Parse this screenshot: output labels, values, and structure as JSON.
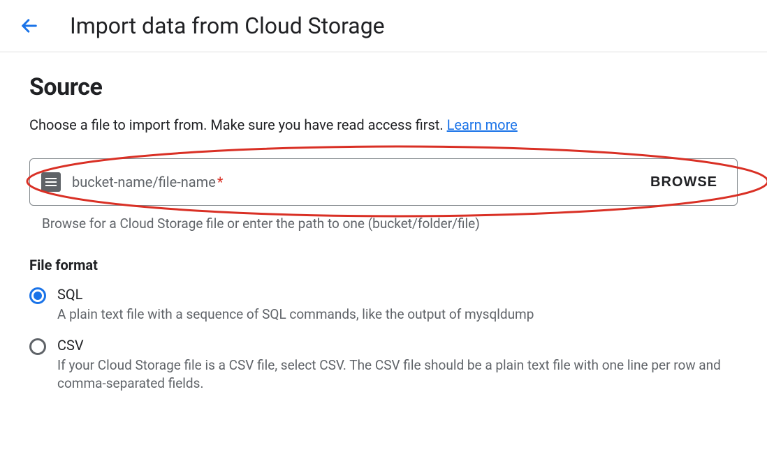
{
  "header": {
    "title": "Import data from Cloud Storage"
  },
  "source": {
    "heading": "Source",
    "description": "Choose a file to import from. Make sure you have read access first. ",
    "learn_more_label": "Learn more",
    "input_placeholder": "bucket-name/file-name",
    "required_star": "*",
    "browse_label": "BROWSE",
    "helper_text": "Browse for a Cloud Storage file or enter the path to one (bucket/folder/file)"
  },
  "file_format": {
    "heading": "File format",
    "options": [
      {
        "label": "SQL",
        "description": "A plain text file with a sequence of SQL commands, like the output of mysqldump",
        "selected": true
      },
      {
        "label": "CSV",
        "description": "If your Cloud Storage file is a CSV file, select CSV. The CSV file should be a plain text file with one line per row and comma-separated fields.",
        "selected": false
      }
    ]
  }
}
